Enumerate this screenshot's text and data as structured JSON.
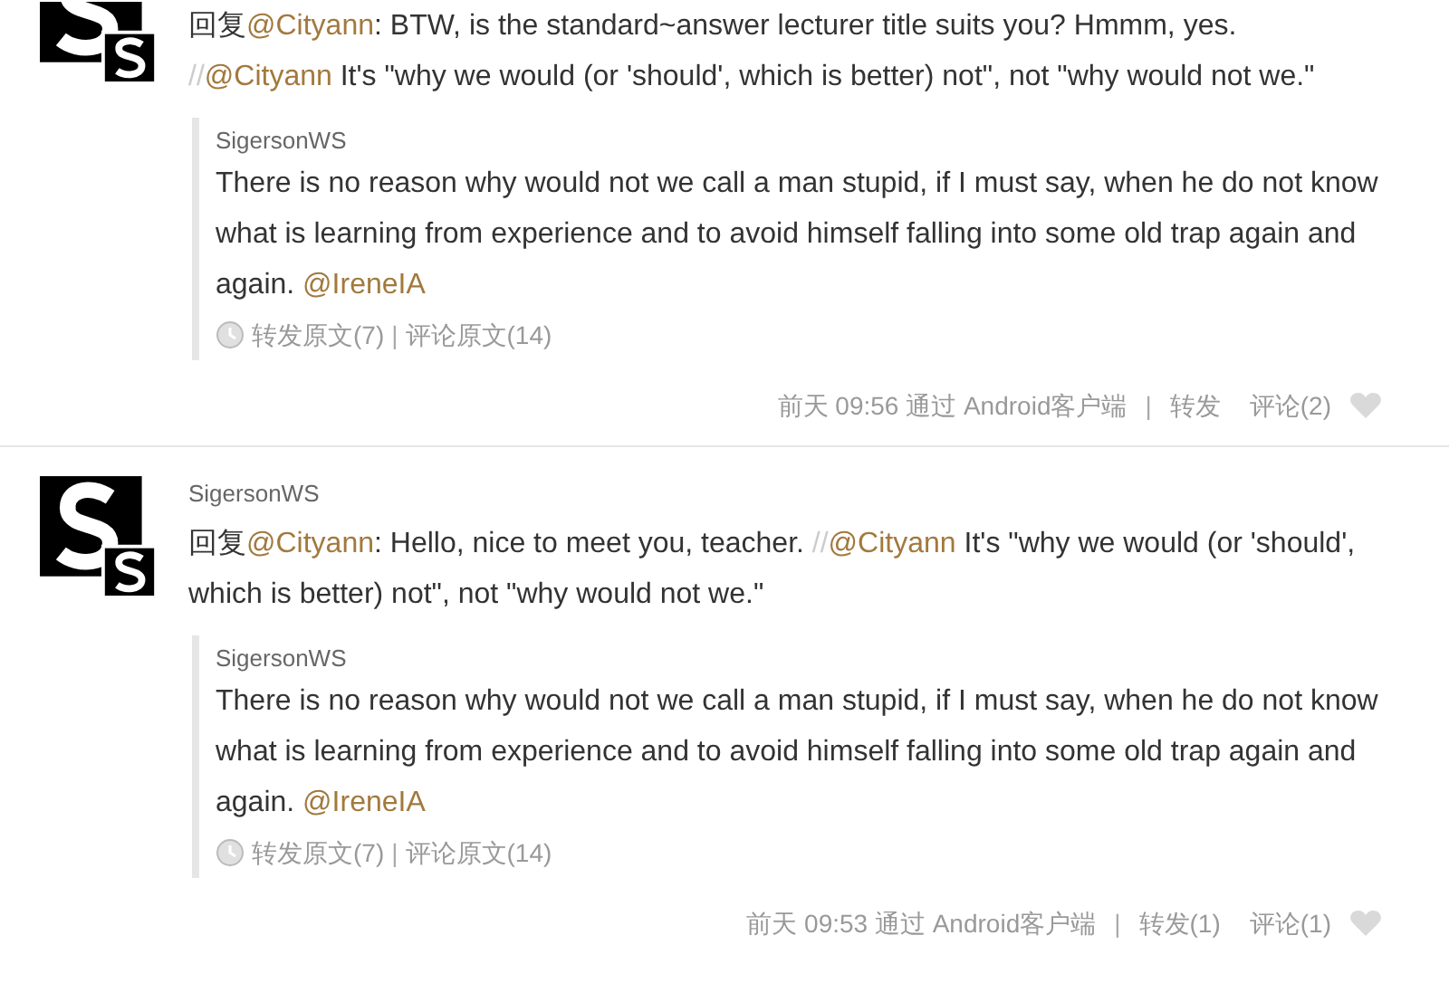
{
  "posts": [
    {
      "avatar_cut": true,
      "message": [
        {
          "kind": "text",
          "text": "回复"
        },
        {
          "kind": "mention",
          "text": "@Cityann"
        },
        {
          "kind": "text",
          "text": ": BTW, is the standard~answer lecturer title suits you? Hmmm, yes. "
        },
        {
          "kind": "separator",
          "text": "//"
        },
        {
          "kind": "mention",
          "text": "@Cityann"
        },
        {
          "kind": "text",
          "text": " It's \"why we would (or 'should', which is better) not\", not \"why would not we.\""
        }
      ],
      "quote": {
        "author": "SigersonWS",
        "text": [
          {
            "kind": "text",
            "text": "There is no reason why would not we call a man stupid, if I must say, when he do not know what is learning from experience and to avoid himself falling into some old trap again and again. "
          },
          {
            "kind": "mention",
            "text": "@IreneIA"
          }
        ],
        "repost_link": "转发原文(7)",
        "link_divider": "|",
        "comment_link": "评论原文(14)"
      },
      "time": "前天 09:56 通过 Android客户端",
      "action_divider": "|",
      "repost": "转发",
      "comment": "评论(2)"
    },
    {
      "author": "SigersonWS",
      "avatar_cut": false,
      "message": [
        {
          "kind": "text",
          "text": "回复"
        },
        {
          "kind": "mention",
          "text": "@Cityann"
        },
        {
          "kind": "text",
          "text": ": Hello, nice to meet you, teacher. "
        },
        {
          "kind": "separator",
          "text": "//"
        },
        {
          "kind": "mention",
          "text": "@Cityann"
        },
        {
          "kind": "text",
          "text": " It's \"why we would (or 'should', which is better) not\", not \"why would not we.\""
        }
      ],
      "quote": {
        "author": "SigersonWS",
        "text": [
          {
            "kind": "text",
            "text": "There is no reason why would not we call a man stupid, if I must say, when he do not know what is learning from experience and to avoid himself falling into some old trap again and again. "
          },
          {
            "kind": "mention",
            "text": "@IreneIA"
          }
        ],
        "repost_link": "转发原文(7)",
        "link_divider": "|",
        "comment_link": "评论原文(14)"
      },
      "time": "前天 09:53 通过 Android客户端",
      "action_divider": "|",
      "repost": "转发(1)",
      "comment": "评论(1)"
    }
  ]
}
